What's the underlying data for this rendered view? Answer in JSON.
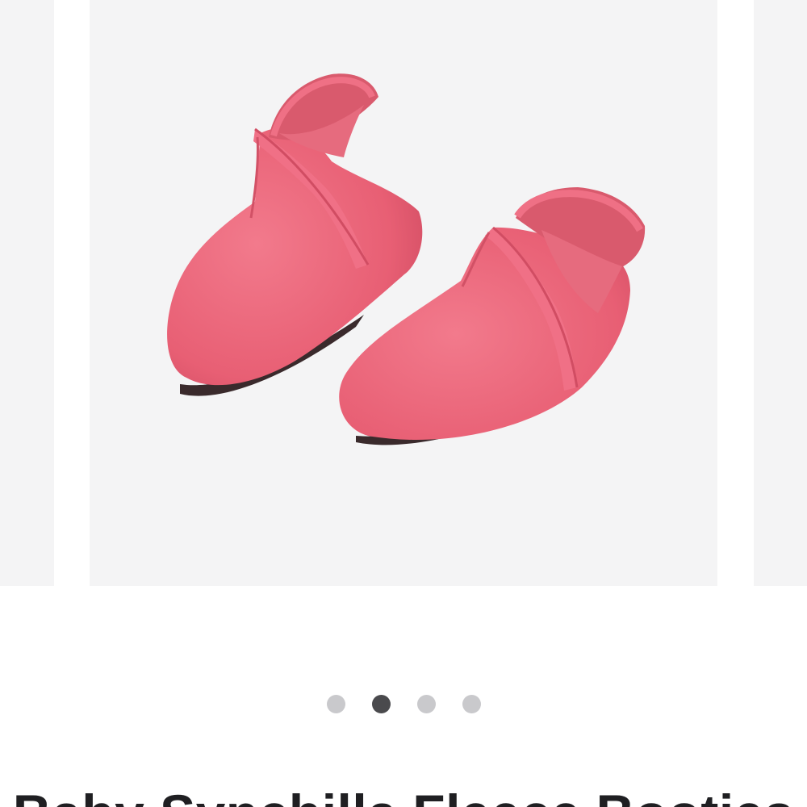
{
  "carousel": {
    "image_alt": "",
    "dots": [
      {
        "active": false
      },
      {
        "active": true
      },
      {
        "active": false
      },
      {
        "active": false
      }
    ]
  },
  "product": {
    "title": "Baby Synchilla Fleece Booties"
  },
  "colors": {
    "slide_background": "#f4f4f5",
    "bootie_pink": "#ea6378",
    "dot_active": "#4a4a4d",
    "dot_inactive": "#c9c9cc"
  }
}
